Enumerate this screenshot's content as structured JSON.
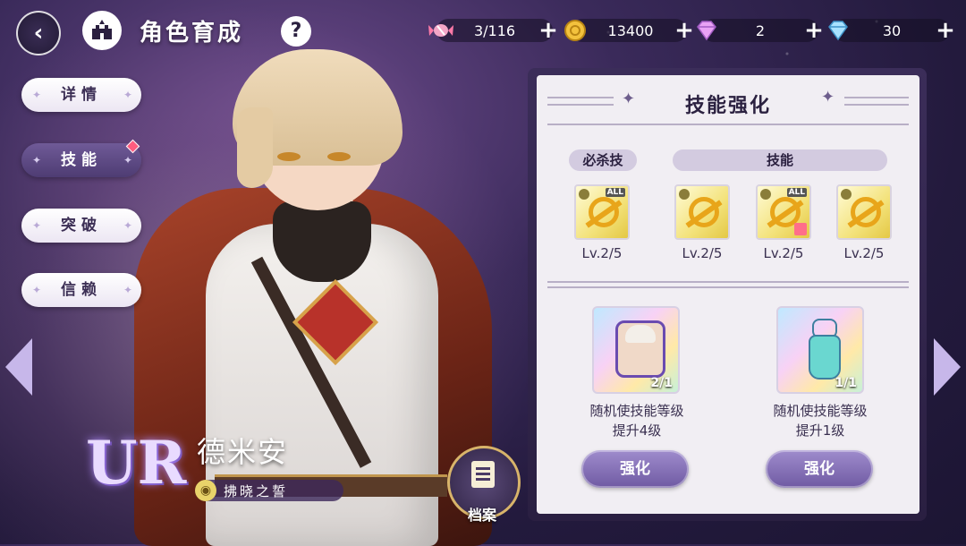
{
  "header": {
    "back_icon": "back-arrow-icon",
    "home_icon": "castle-icon",
    "title": "角色育成",
    "help_label": "?"
  },
  "resources": [
    {
      "icon": "candy-icon",
      "value": "3/116"
    },
    {
      "icon": "gold-coin-icon",
      "value": "13400"
    },
    {
      "icon": "pink-diamond-icon",
      "value": "2"
    },
    {
      "icon": "blue-diamond-icon",
      "value": "30"
    }
  ],
  "plus_label": "+",
  "nav": {
    "items": [
      {
        "label": "详情",
        "active": false
      },
      {
        "label": "技能",
        "active": true,
        "badge": true
      },
      {
        "label": "突破",
        "active": false
      },
      {
        "label": "信赖",
        "active": false
      }
    ]
  },
  "character": {
    "rarity": "UR",
    "name": "德米安",
    "title": "拂晓之誓"
  },
  "archive_label": "档案",
  "panel": {
    "title": "技能强化",
    "ultimate_tag": "必杀技",
    "skill_tag": "技能",
    "skills": [
      {
        "level": "Lv.2/5",
        "badge": "ALL"
      },
      {
        "level": "Lv.2/5",
        "badge": ""
      },
      {
        "level": "Lv.2/5",
        "badge": "ALL"
      },
      {
        "level": "Lv.2/5",
        "badge": ""
      }
    ],
    "items": [
      {
        "count": "2/1",
        "desc1": "随机使技能等级",
        "desc2": "提升4级",
        "button": "强化"
      },
      {
        "count": "1/1",
        "desc1": "随机使技能等级",
        "desc2": "提升1级",
        "button": "强化"
      }
    ]
  },
  "colors": {
    "accent_purple": "#6f5aa3",
    "panel_bg": "#f1eef3",
    "nav_active": "#4e3c73",
    "badge_red": "#ff5c7f"
  }
}
